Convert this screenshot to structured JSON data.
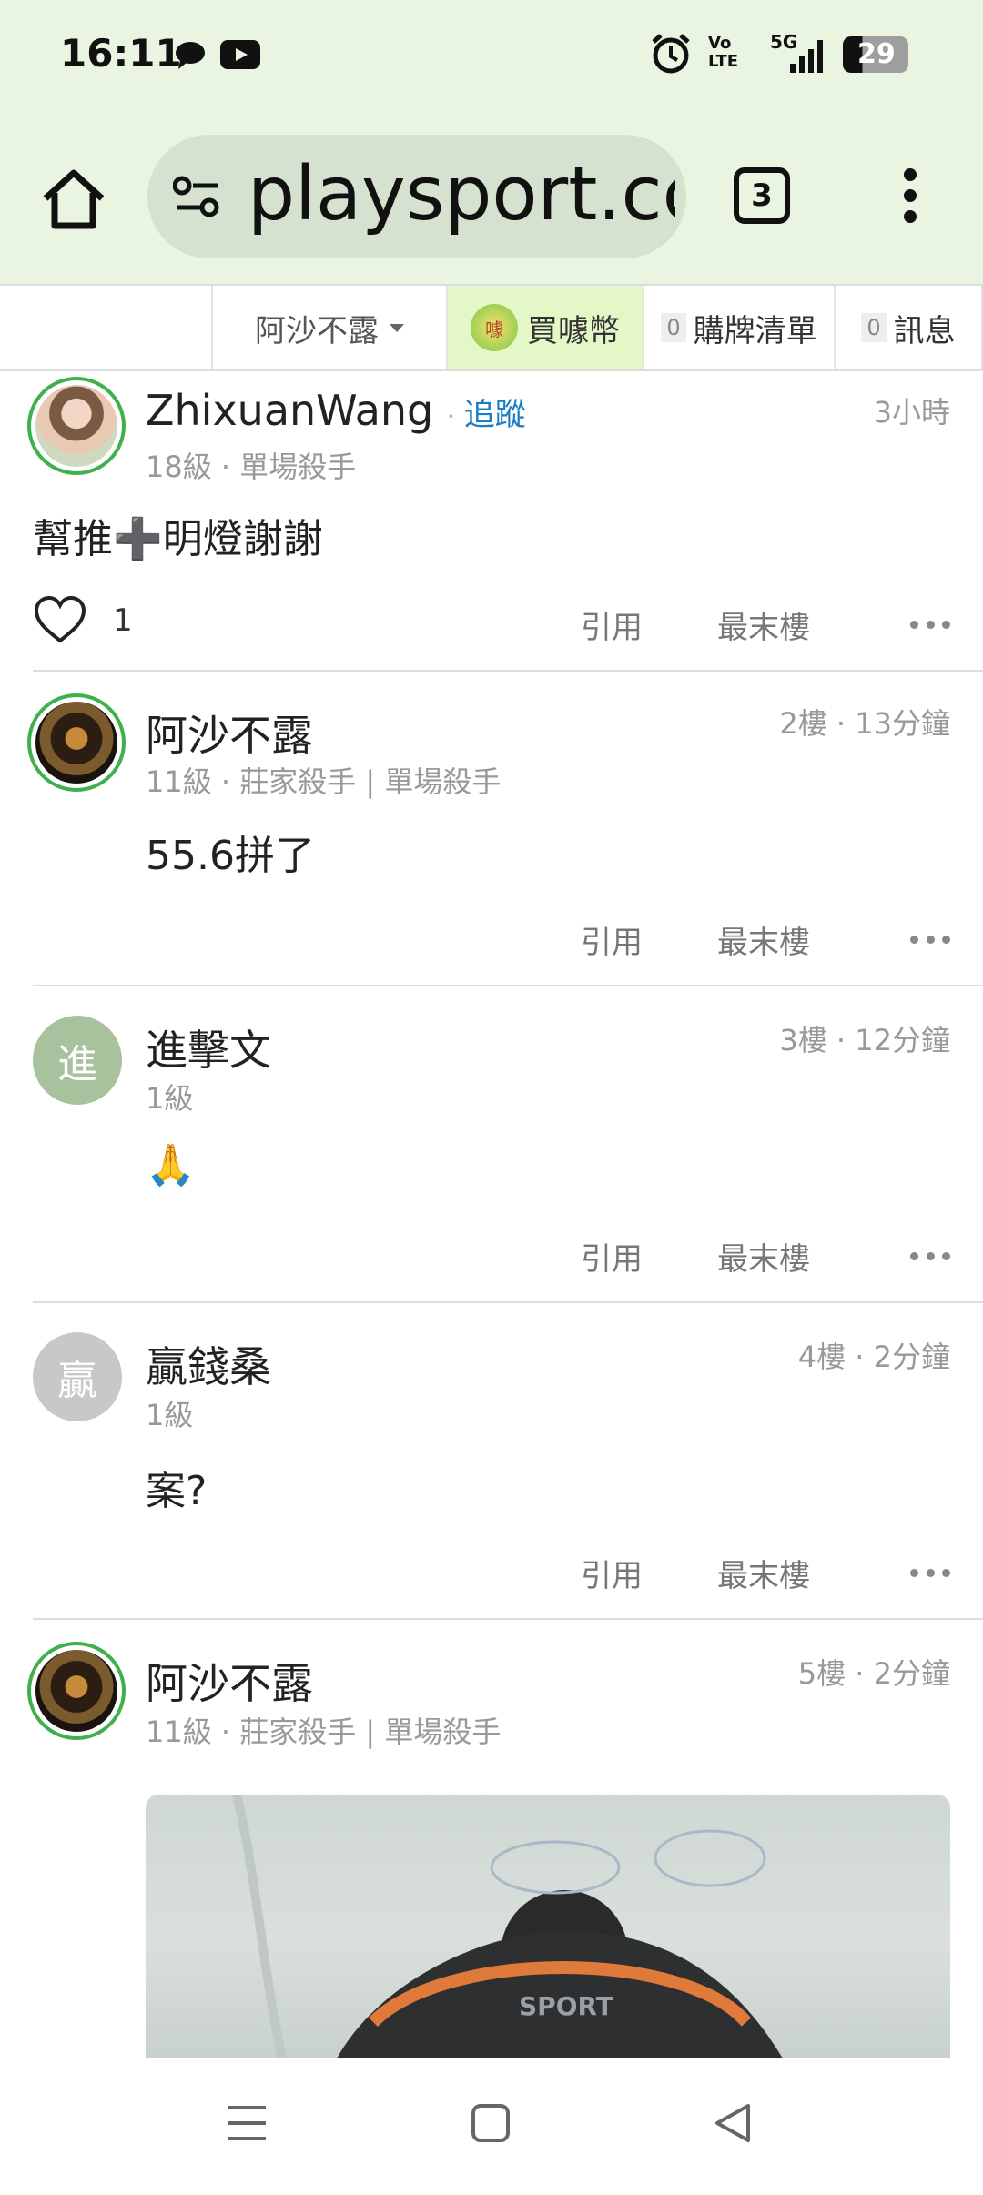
{
  "status_bar": {
    "time": "16:11",
    "network": "5G",
    "volte": "Vo LTE",
    "battery": "29"
  },
  "browser": {
    "url": "playsport.cc",
    "tab_count": "3"
  },
  "site_nav": {
    "user": "阿沙不露",
    "coin": "買噱幣",
    "coin_icon_text": "噱",
    "list_count": "0",
    "list": "購牌清單",
    "msg_count": "0",
    "messages": "訊息"
  },
  "actions": {
    "quote": "引用",
    "last_floor": "最末樓"
  },
  "posts": [
    {
      "name": "ZhixuanWang",
      "follow": "追蹤",
      "meta": "18級 · 單場殺手",
      "time": "3小時",
      "content": "幫推➕明燈謝謝",
      "likes": "1"
    },
    {
      "name": "阿沙不露",
      "meta": "11級 · 莊家殺手 | 單場殺手",
      "time": "2樓 · 13分鐘",
      "content": "55.6拼了"
    },
    {
      "name": "進擊文",
      "avatar_letter": "進",
      "meta": "1級",
      "time": "3樓 · 12分鐘",
      "content": "🙏"
    },
    {
      "name": "贏錢桑",
      "avatar_letter": "贏",
      "meta": "1級",
      "time": "4樓 · 2分鐘",
      "content": "案?"
    },
    {
      "name": "阿沙不露",
      "meta": "11級 · 莊家殺手 | 單場殺手",
      "time": "5樓 · 2分鐘"
    }
  ],
  "photo_text": "SPORT",
  "colors": {
    "chrome_bg": "#e9f5e1",
    "follow_link": "#1b7ec2",
    "avatar_ring": "#3fb04c",
    "coin_bg": "#e4f7c7"
  }
}
